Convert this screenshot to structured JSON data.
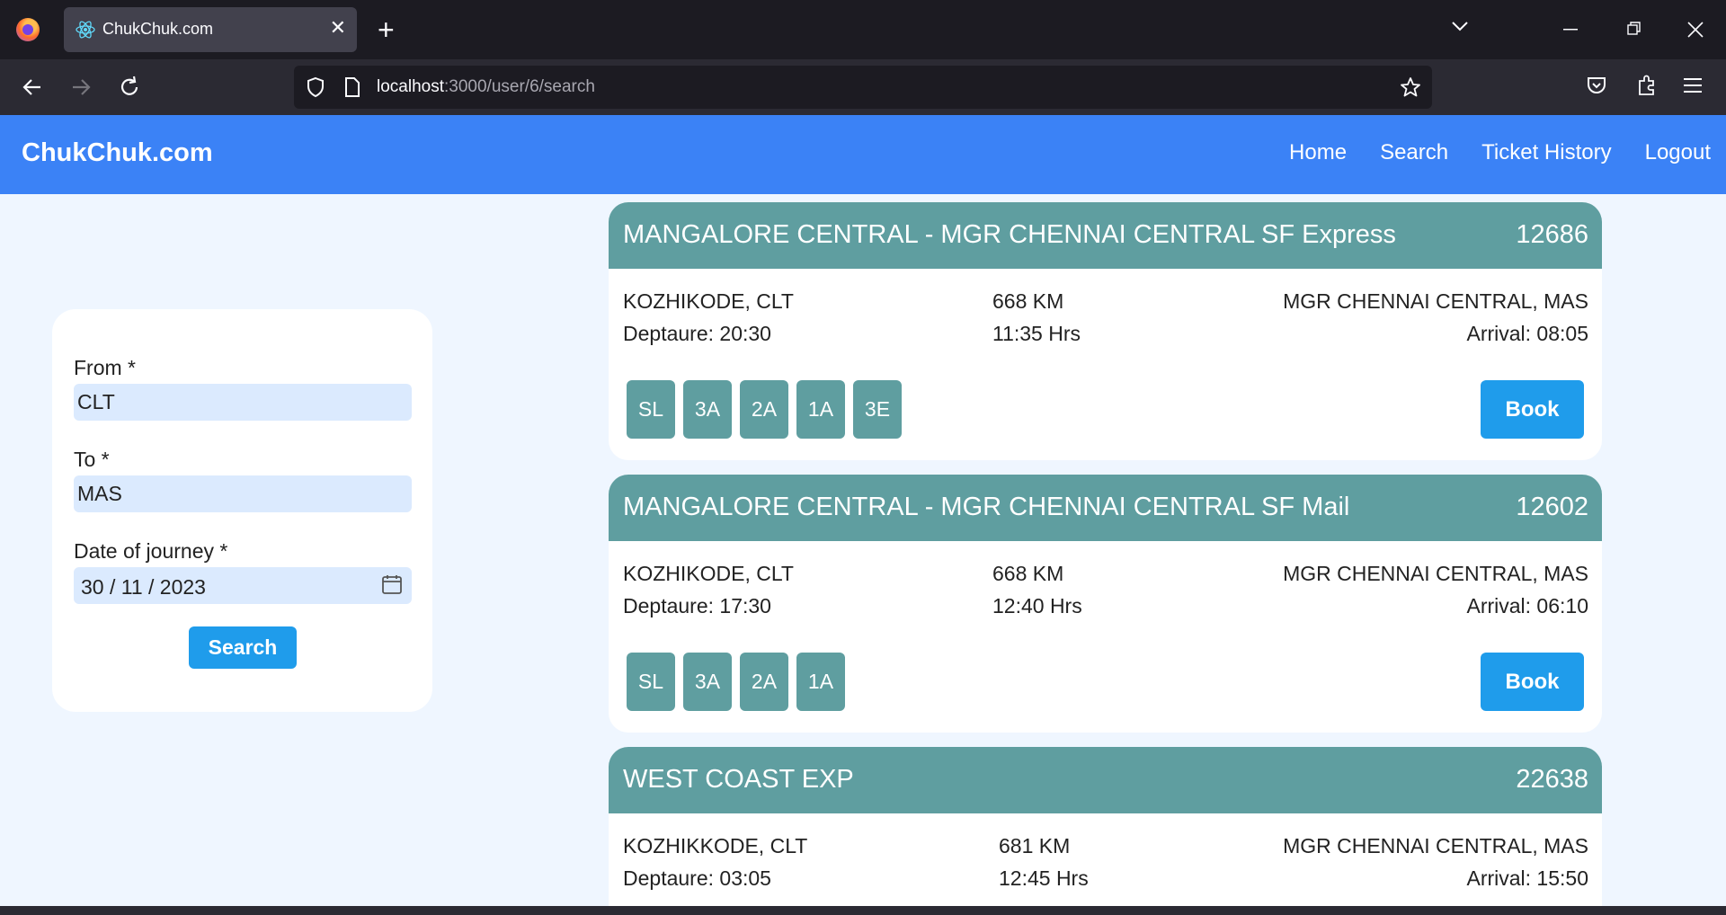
{
  "browser": {
    "tab_title": "ChukChuk.com",
    "tab_close": "✕",
    "new_tab": "+",
    "url_host": "localhost",
    "url_path": ":3000/user/6/search"
  },
  "app": {
    "brand": "ChukChuk.com",
    "nav": [
      "Home",
      "Search",
      "Ticket History",
      "Logout"
    ]
  },
  "search_form": {
    "from_label": "From *",
    "from_value": "CLT",
    "to_label": "To *",
    "to_value": "MAS",
    "date_label": "Date of journey *",
    "date_value": "30 / 11 / 2023",
    "search_button": "Search"
  },
  "trains": [
    {
      "name": "MANGALORE CENTRAL - MGR CHENNAI CENTRAL SF Express",
      "number": "12686",
      "from_station": "KOZHIKODE, CLT",
      "departure": "Deptaure: 20:30",
      "distance": "668 KM",
      "duration": "11:35 Hrs",
      "to_station": "MGR CHENNAI CENTRAL, MAS",
      "arrival": "Arrival: 08:05",
      "classes": [
        "SL",
        "3A",
        "2A",
        "1A",
        "3E"
      ],
      "book_label": "Book"
    },
    {
      "name": "MANGALORE CENTRAL - MGR CHENNAI CENTRAL SF Mail",
      "number": "12602",
      "from_station": "KOZHIKODE, CLT",
      "departure": "Deptaure: 17:30",
      "distance": "668 KM",
      "duration": "12:40 Hrs",
      "to_station": "MGR CHENNAI CENTRAL, MAS",
      "arrival": "Arrival: 06:10",
      "classes": [
        "SL",
        "3A",
        "2A",
        "1A"
      ],
      "book_label": "Book"
    },
    {
      "name": "WEST COAST EXP",
      "number": "22638",
      "from_station": "KOZHIKKODE, CLT",
      "departure": "Deptaure: 03:05",
      "distance": "681 KM",
      "duration": "12:45 Hrs",
      "to_station": "MGR CHENNAI CENTRAL, MAS",
      "arrival": "Arrival: 15:50"
    }
  ]
}
